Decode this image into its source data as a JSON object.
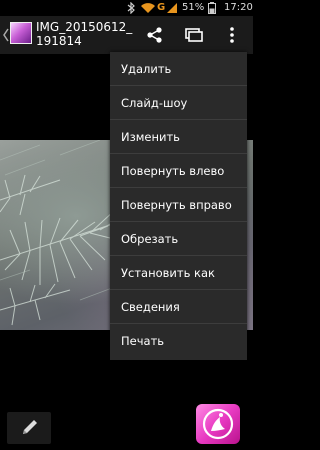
{
  "status_bar": {
    "bluetooth_icon": "bluetooth-icon",
    "wifi_icon": "wifi-icon",
    "network_label": "G",
    "battery_percent": "51%",
    "time": "17:20"
  },
  "action_bar": {
    "title": "IMG_20150612_\n191814",
    "share_icon": "share-icon",
    "slideshow_icon": "slideshow-icon",
    "overflow_icon": "more-vert-icon"
  },
  "menu": {
    "items": [
      {
        "label": "Удалить"
      },
      {
        "label": "Слайд-шоу"
      },
      {
        "label": "Изменить"
      },
      {
        "label": "Повернуть влево"
      },
      {
        "label": "Повернуть вправо"
      },
      {
        "label": "Обрезать"
      },
      {
        "label": "Установить как"
      },
      {
        "label": "Сведения"
      },
      {
        "label": "Печать"
      }
    ]
  },
  "bottom": {
    "edit_icon": "pencil-icon",
    "app_icon": "photo-editor-app-icon"
  },
  "colors": {
    "menu_bg": "#2a2a2a",
    "action_bar_bg": "#1b1b1b",
    "network_orange": "#e8951e",
    "app_pink": "#e83bc2"
  }
}
